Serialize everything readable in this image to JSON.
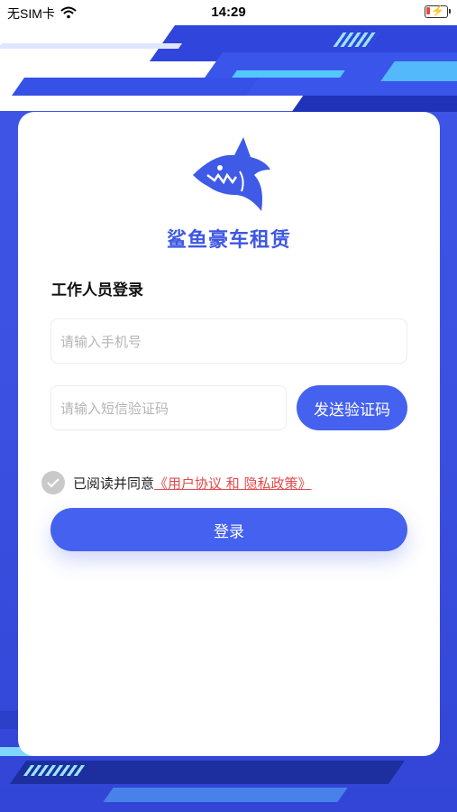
{
  "status_bar": {
    "carrier": "无SIM卡",
    "time": "14:29"
  },
  "app": {
    "brand_name": "鲨鱼豪车租赁",
    "accent_color": "#4461ef",
    "logo_icon": "shark-logo-icon"
  },
  "login": {
    "title": "工作人员登录",
    "phone_placeholder": "请输入手机号",
    "code_placeholder": "请输入短信验证码",
    "send_code_label": "发送验证码",
    "agreement_prefix": "已阅读并同意",
    "agreement_link": "《用户协议 和 隐私政策》",
    "submit_label": "登录"
  }
}
